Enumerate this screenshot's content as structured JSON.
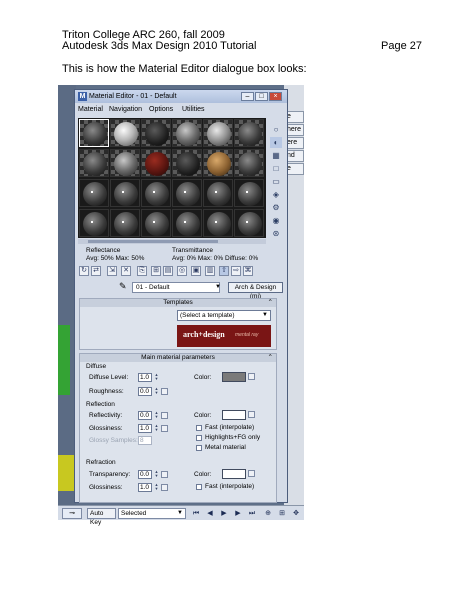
{
  "page_header": {
    "line1": "Triton College ARC 260, fall 2009",
    "line2": "Autodesk 3ds Max Design 2010 Tutorial",
    "page": "Page 27"
  },
  "intro": "This is how the Material Editor dialogue box looks:",
  "right_panel_tabs": [
    "e",
    "here",
    "ere",
    "nd",
    "e"
  ],
  "window": {
    "title": "Material Editor - 01 - Default",
    "icon_letter": "M",
    "menu": [
      "Material",
      "Navigation",
      "Options",
      "Utilities"
    ]
  },
  "reflectance": {
    "label": "Reflectance",
    "values": "Avg:  50% Max:  50%"
  },
  "transmittance": {
    "label": "Transmittance",
    "values": "Avg:   0% Max:   0%  Diffuse:   0%"
  },
  "material_name": "01 - Default",
  "material_type": "Arch & Design (mi)",
  "templates": {
    "header": "Templates",
    "dropdown": "(Select a template)",
    "banner_main": "arch+design",
    "banner_sub": "mental ray"
  },
  "main_params": {
    "header": "Main material parameters",
    "diffuse": {
      "group": "Diffuse",
      "level_label": "Diffuse Level:",
      "level_value": "1.0",
      "roughness_label": "Roughness:",
      "roughness_value": "0.0",
      "color_label": "Color:",
      "color": "#7a7a7a"
    },
    "reflection": {
      "group": "Reflection",
      "reflectivity_label": "Reflectivity:",
      "reflectivity_value": "0.0",
      "glossiness_label": "Glossiness:",
      "glossiness_value": "1.0",
      "samples_label": "Glossy Samples:",
      "samples_value": "8",
      "color_label": "Color:",
      "color": "#ffffff",
      "fast_label": "Fast (interpolate)",
      "highlights_label": "Highlights+FG only",
      "metal_label": "Metal material"
    },
    "refraction": {
      "group": "Refraction",
      "transparency_label": "Transparency:",
      "transparency_value": "0.0",
      "glossiness_label": "Glossiness:",
      "glossiness_value": "1.0",
      "color_label": "Color:",
      "color": "#ffffff",
      "fast_label": "Fast (interpolate)"
    }
  },
  "bottom_bar": {
    "autokey": "Auto Key",
    "selected": "Selected"
  }
}
